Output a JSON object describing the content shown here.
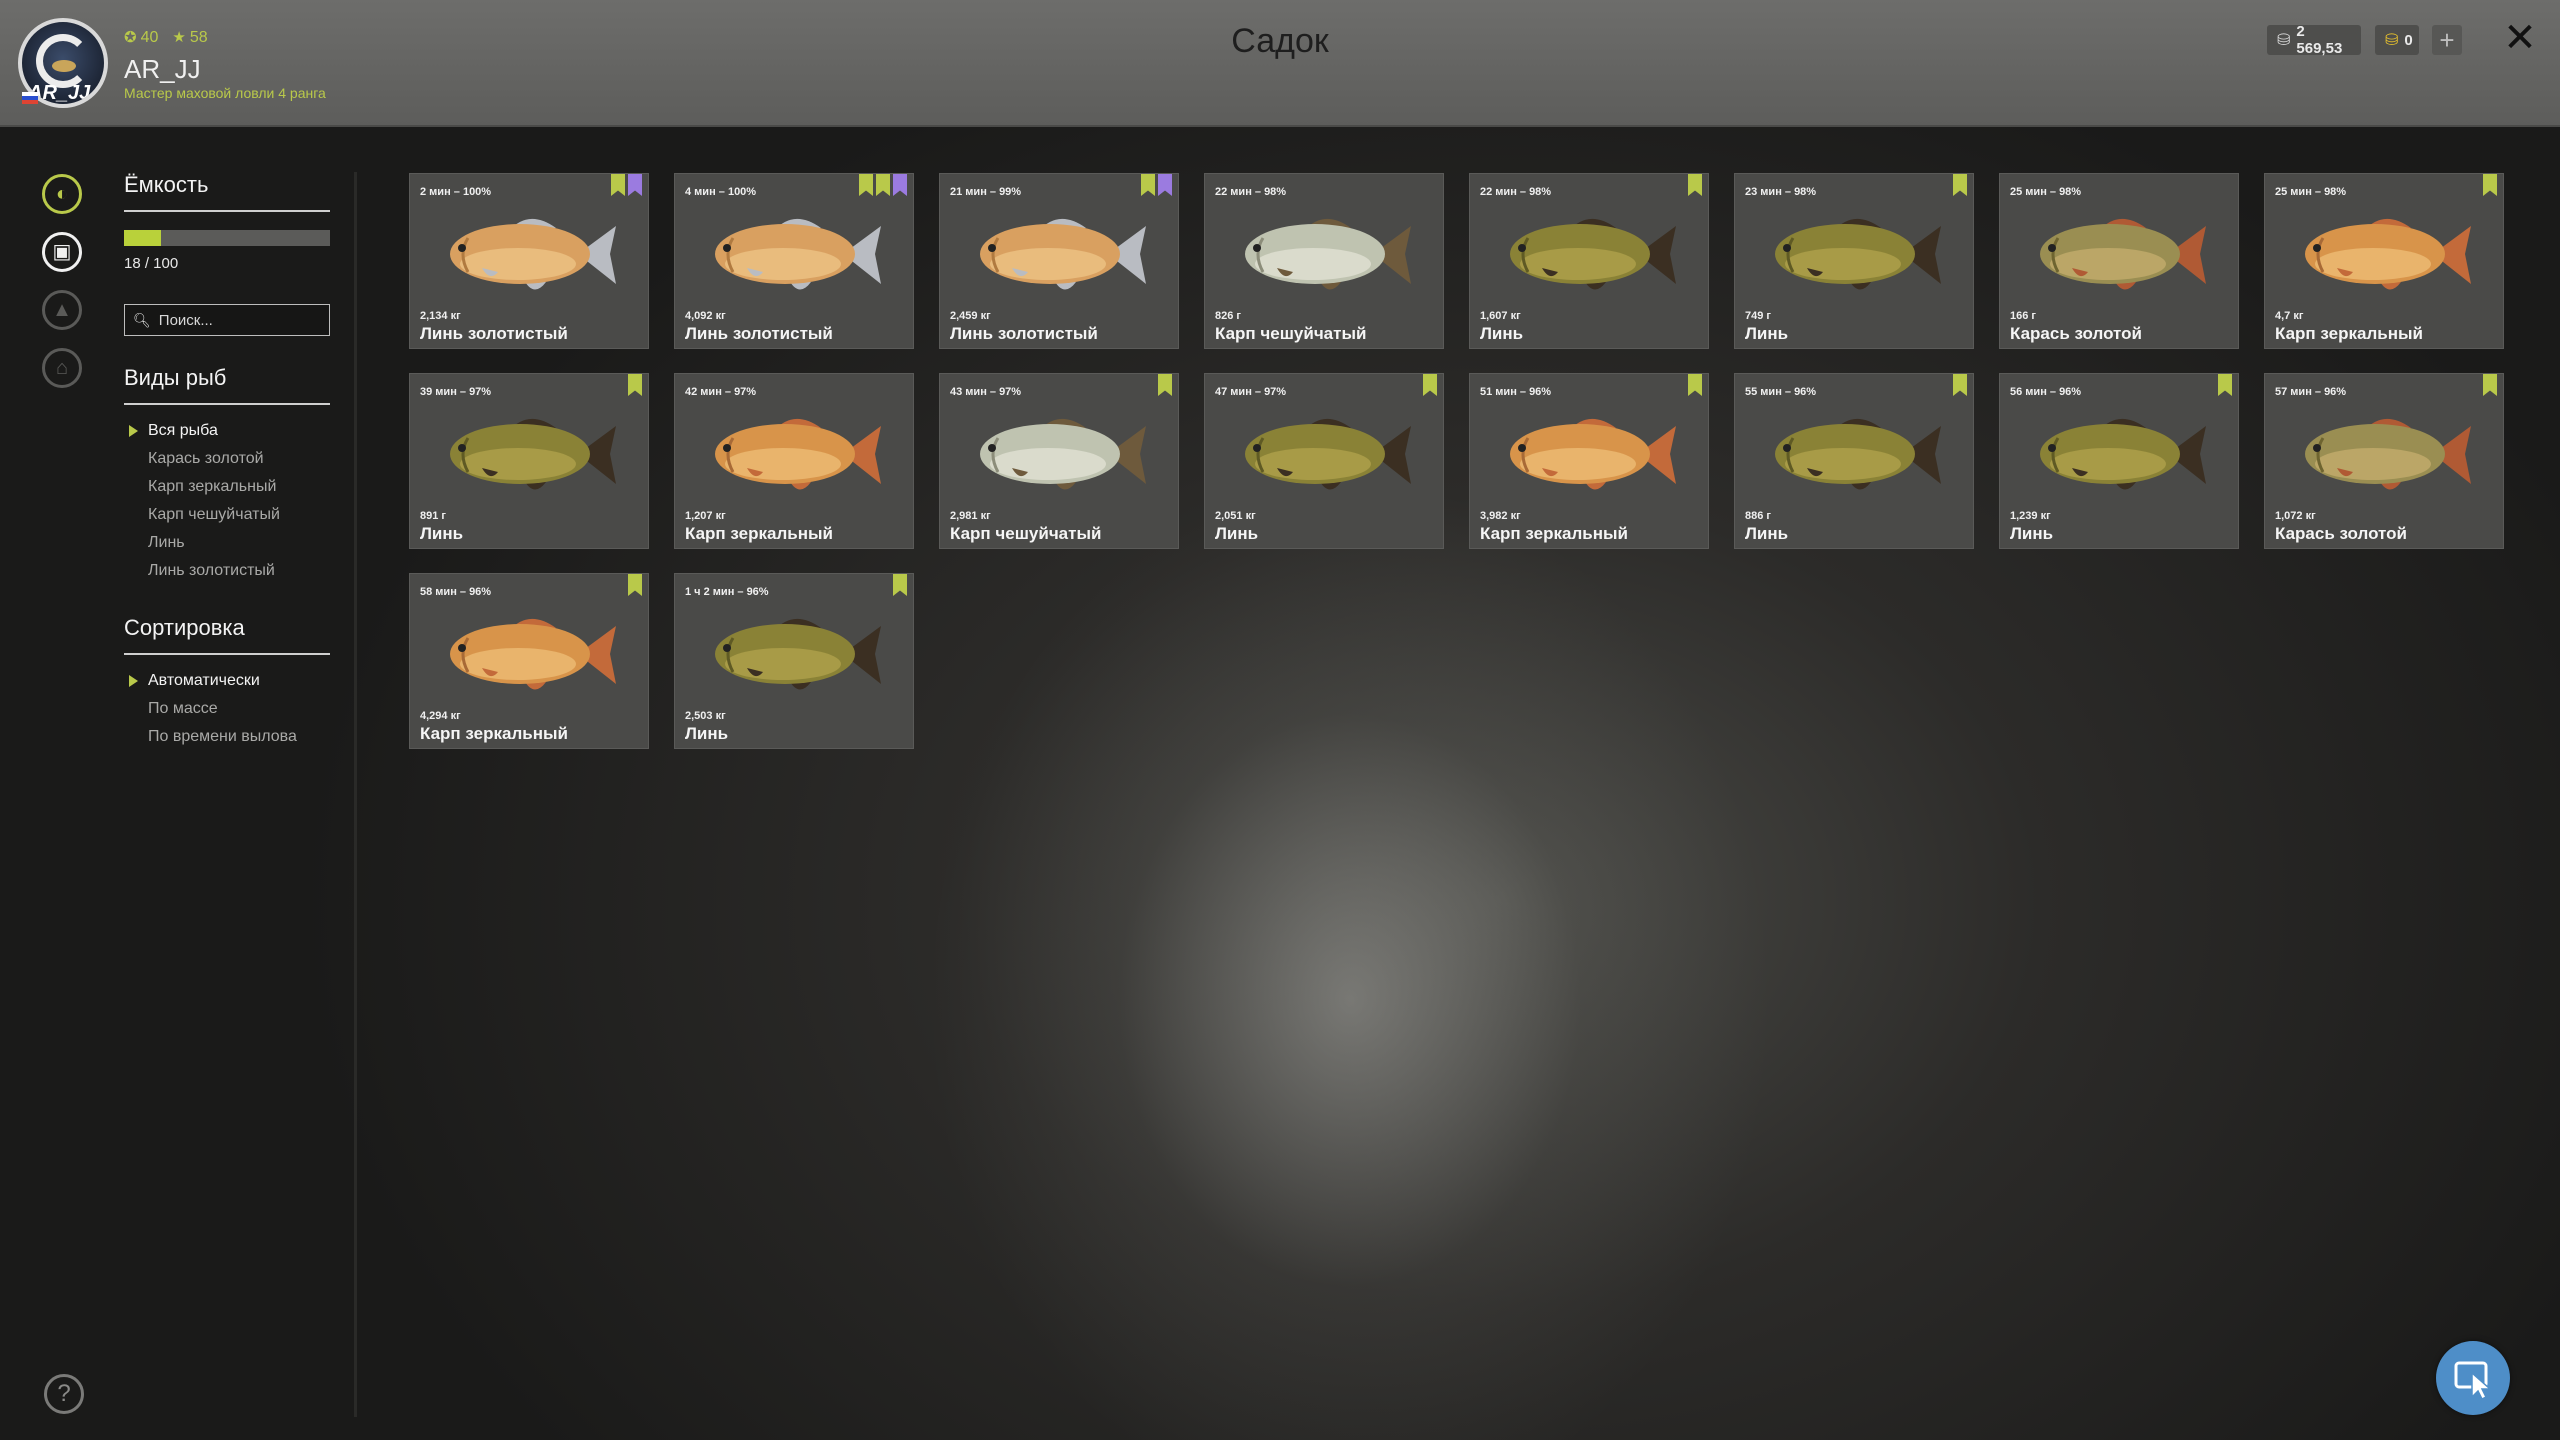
{
  "header": {
    "title": "Садок",
    "username": "AR_JJ",
    "avatar_tag": "AR_JJ",
    "rank": "Мастер маховой ловли 4 ранга",
    "stat_level": "40",
    "stat_stars": "58",
    "silver": "2 569,53",
    "gold": "0",
    "plus": "+",
    "close": "✕"
  },
  "sidebar": {
    "capacity_title": "Ёмкость",
    "capacity_text": "18 / 100",
    "capacity_fraction": 0.18,
    "search_placeholder": "Поиск...",
    "species_title": "Виды рыб",
    "species": [
      "Вся рыба",
      "Карась золотой",
      "Карп зеркальный",
      "Карп чешуйчатый",
      "Линь",
      "Линь золотистый"
    ],
    "sort_title": "Сортировка",
    "sort": [
      "Автоматически",
      "По массе",
      "По времени вылова"
    ]
  },
  "colors": {
    "accent": "#b9c94a",
    "bookmark_purple": "#9b7be0"
  },
  "fish": [
    {
      "time": "2 мин – 100%",
      "weight": "2,134 кг",
      "name": "Линь золотистый",
      "type": "golden-tench",
      "marks": [
        "green",
        "purple"
      ]
    },
    {
      "time": "4 мин – 100%",
      "weight": "4,092 кг",
      "name": "Линь золотистый",
      "type": "golden-tench",
      "marks": [
        "green",
        "green",
        "purple"
      ]
    },
    {
      "time": "21 мин – 99%",
      "weight": "2,459 кг",
      "name": "Линь золотистый",
      "type": "golden-tench",
      "marks": [
        "green",
        "purple"
      ]
    },
    {
      "time": "22 мин – 98%",
      "weight": "826 г",
      "name": "Карп чешуйчатый",
      "type": "scaled-carp",
      "marks": []
    },
    {
      "time": "22 мин – 98%",
      "weight": "1,607 кг",
      "name": "Линь",
      "type": "tench",
      "marks": [
        "green"
      ]
    },
    {
      "time": "23 мин – 98%",
      "weight": "749 г",
      "name": "Линь",
      "type": "tench",
      "marks": [
        "green"
      ]
    },
    {
      "time": "25 мин – 98%",
      "weight": "166 г",
      "name": "Карась золотой",
      "type": "crucian",
      "marks": []
    },
    {
      "time": "25 мин – 98%",
      "weight": "4,7 кг",
      "name": "Карп зеркальный",
      "type": "mirror-carp",
      "marks": [
        "green"
      ]
    },
    {
      "time": "39 мин – 97%",
      "weight": "891 г",
      "name": "Линь",
      "type": "tench",
      "marks": [
        "green"
      ]
    },
    {
      "time": "42 мин – 97%",
      "weight": "1,207 кг",
      "name": "Карп зеркальный",
      "type": "mirror-carp",
      "marks": []
    },
    {
      "time": "43 мин – 97%",
      "weight": "2,981 кг",
      "name": "Карп чешуйчатый",
      "type": "scaled-carp",
      "marks": [
        "green"
      ]
    },
    {
      "time": "47 мин – 97%",
      "weight": "2,051 кг",
      "name": "Линь",
      "type": "tench",
      "marks": [
        "green"
      ]
    },
    {
      "time": "51 мин – 96%",
      "weight": "3,982 кг",
      "name": "Карп зеркальный",
      "type": "mirror-carp",
      "marks": [
        "green"
      ]
    },
    {
      "time": "55 мин – 96%",
      "weight": "886 г",
      "name": "Линь",
      "type": "tench",
      "marks": [
        "green"
      ]
    },
    {
      "time": "56 мин – 96%",
      "weight": "1,239 кг",
      "name": "Линь",
      "type": "tench",
      "marks": [
        "green"
      ]
    },
    {
      "time": "57 мин – 96%",
      "weight": "1,072 кг",
      "name": "Карась золотой",
      "type": "crucian",
      "marks": [
        "green"
      ]
    },
    {
      "time": "58 мин – 96%",
      "weight": "4,294 кг",
      "name": "Карп зеркальный",
      "type": "mirror-carp",
      "marks": [
        "green"
      ]
    },
    {
      "time": "1 ч 2 мин – 96%",
      "weight": "2,503 кг",
      "name": "Линь",
      "type": "tench",
      "marks": [
        "green"
      ]
    }
  ]
}
